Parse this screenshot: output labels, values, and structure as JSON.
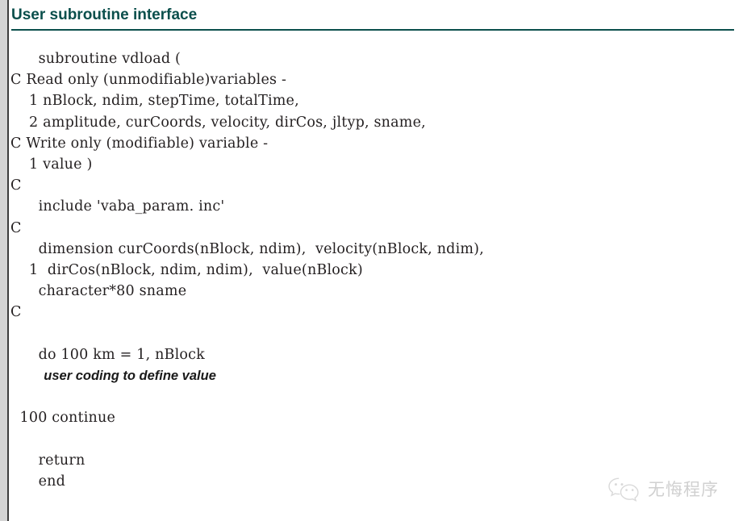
{
  "header": {
    "title": "User subroutine interface",
    "accent_color": "#0b4f4c"
  },
  "code": {
    "language": "fortran",
    "lines": [
      "      subroutine vdload (",
      "C Read only (unmodifiable)variables -",
      "    1 nBlock, ndim, stepTime, totalTime,",
      "    2 amplitude, curCoords, velocity, dirCos, jltyp, sname,",
      "C Write only (modifiable) variable -",
      "    1 value )",
      "C",
      "      include 'vaba_param. inc'",
      "C",
      "      dimension curCoords(nBlock, ndim),  velocity(nBlock, ndim),",
      "    1  dirCos(nBlock, ndim, ndim),  value(nBlock)",
      "      character*80 sname",
      "C",
      "",
      "      do 100 km = 1, nBlock",
      "         user coding to define value",
      "",
      "  100 continue",
      "",
      "      return",
      "      end"
    ],
    "note_line_index": 15,
    "blank_line_indices": [
      13,
      16,
      18
    ],
    "text_color": "#231f20"
  },
  "watermark": {
    "logo_name": "wechat-logo",
    "text": "无悔程序",
    "color": "#b4b4b4"
  }
}
